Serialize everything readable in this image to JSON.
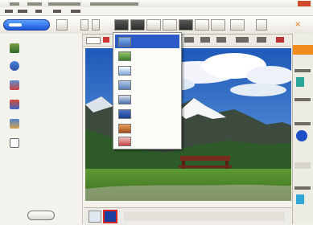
{
  "colors": {
    "accent": "#1b56d6",
    "selection": "#2c5ac7",
    "orange": "#f08a1a"
  },
  "window": {
    "title": "",
    "menu": [
      "",
      "",
      "",
      "",
      "",
      ""
    ]
  },
  "toolbar": {
    "close_icon": "×"
  },
  "sidebar": {
    "items": [
      {
        "label": "",
        "icon": "photo-icon"
      },
      {
        "label": "",
        "icon": "users-icon"
      },
      {
        "label": "",
        "icon": "people-icon"
      },
      {
        "label": "",
        "icon": "group-icon"
      },
      {
        "label": "",
        "icon": "person-icon"
      },
      {
        "label": "",
        "icon": "document-icon"
      }
    ],
    "bottom_button": ""
  },
  "dropdown": {
    "items": [
      {
        "label": "",
        "selected": true
      },
      {
        "label": "",
        "selected": false
      },
      {
        "label": "",
        "selected": false
      },
      {
        "label": "",
        "selected": false
      },
      {
        "label": "",
        "selected": false
      },
      {
        "label": "",
        "selected": false
      },
      {
        "label": "",
        "selected": false
      },
      {
        "label": "",
        "selected": false
      }
    ]
  },
  "filmstrip": {
    "thumbnails": 2,
    "selected_index": 1
  }
}
